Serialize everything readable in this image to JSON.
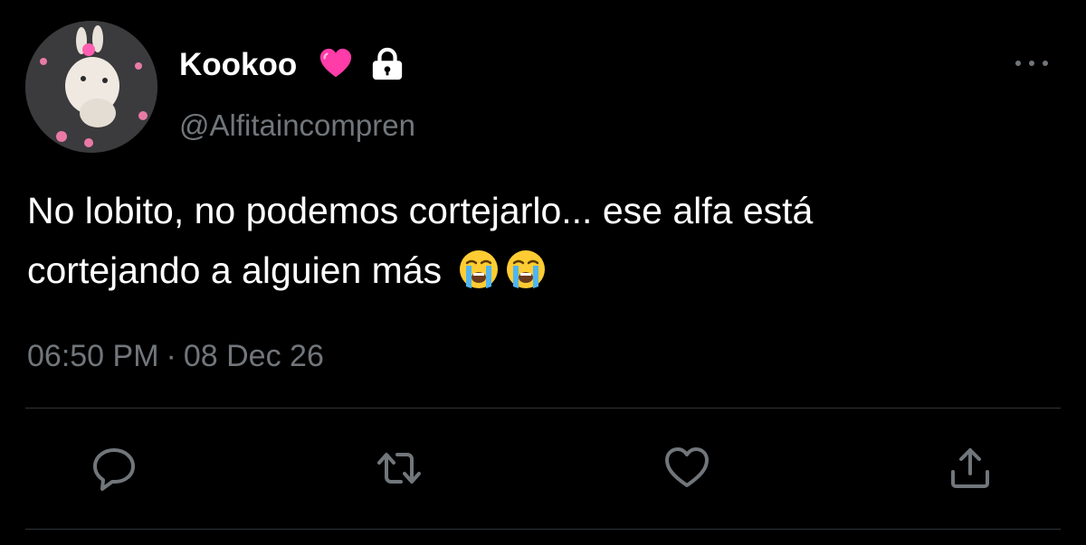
{
  "user": {
    "display_name": "Kookoo",
    "handle": "@Alfitaincompren",
    "badge_icons": [
      "pink-heart-emoji",
      "lock-icon"
    ]
  },
  "tweet": {
    "line1": "No lobito, no podemos cortejarlo... ese alfa está",
    "line2": "cortejando a alguien más",
    "emojis": [
      "loudly-crying-face",
      "loudly-crying-face"
    ],
    "time": "06:50 PM",
    "separator": "·",
    "date": "08 Dec 26"
  },
  "actions": [
    "reply-icon",
    "retweet-icon",
    "like-icon",
    "share-icon"
  ],
  "colors": {
    "background": "#000000",
    "text": "#ffffff",
    "muted": "#71767b",
    "divider": "#2f3336",
    "heart": "#ff3ca8"
  }
}
